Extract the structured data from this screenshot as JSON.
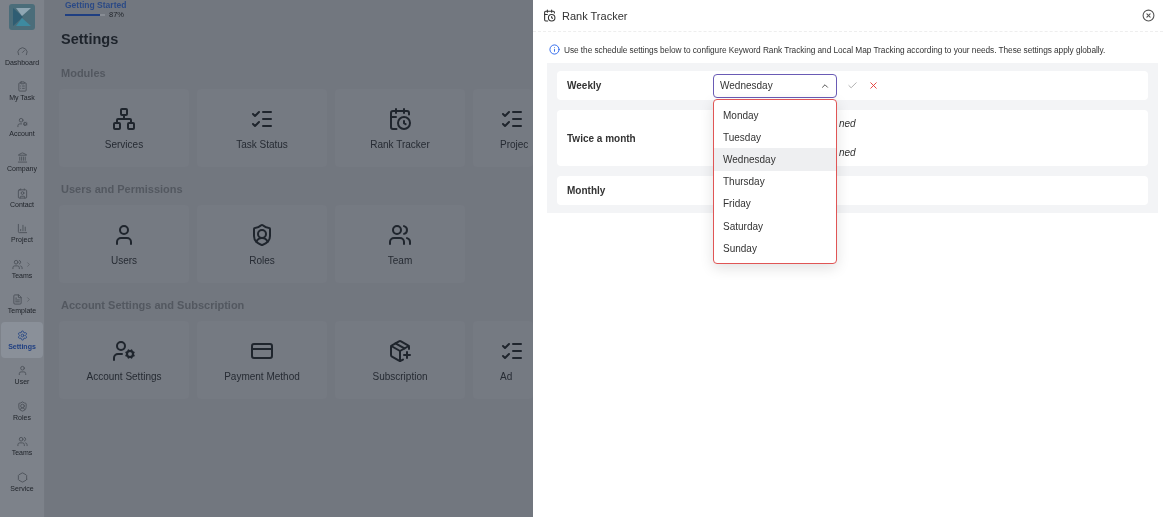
{
  "sidebar": {
    "items": [
      {
        "label": "Dashboard",
        "selected": false,
        "expandable": false
      },
      {
        "label": "My Task",
        "selected": false,
        "expandable": false
      },
      {
        "label": "Account",
        "selected": false,
        "expandable": false
      },
      {
        "label": "Company",
        "selected": false,
        "expandable": false
      },
      {
        "label": "Contact",
        "selected": false,
        "expandable": false
      },
      {
        "label": "Project",
        "selected": false,
        "expandable": false
      },
      {
        "label": "Teams",
        "selected": false,
        "expandable": true
      },
      {
        "label": "Template",
        "selected": false,
        "expandable": true
      },
      {
        "label": "Settings",
        "selected": true,
        "expandable": false
      },
      {
        "label": "User",
        "selected": false,
        "expandable": false
      },
      {
        "label": "Roles",
        "selected": false,
        "expandable": false
      },
      {
        "label": "Teams",
        "selected": false,
        "expandable": false
      },
      {
        "label": "Service",
        "selected": false,
        "expandable": false
      }
    ]
  },
  "progress": {
    "title": "Getting Started",
    "level": 0.87,
    "reading": "87%"
  },
  "page": {
    "title": "Settings",
    "sections": [
      {
        "title": "Modules",
        "cards": [
          {
            "label": "Services"
          },
          {
            "label": "Task Status"
          },
          {
            "label": "Rank Tracker"
          },
          {
            "label": "Projec",
            "partial": true
          }
        ]
      },
      {
        "title": "Users and Permissions",
        "cards": [
          {
            "label": "Users"
          },
          {
            "label": "Roles"
          },
          {
            "label": "Team"
          }
        ]
      },
      {
        "title": "Account Settings and Subscription",
        "cards": [
          {
            "label": "Account Settings"
          },
          {
            "label": "Payment Method"
          },
          {
            "label": "Subscription"
          },
          {
            "label": "Ad",
            "partial": true
          }
        ]
      }
    ]
  },
  "drawer": {
    "title": "Rank Tracker",
    "info": "Use the schedule settings below to configure Keyword Rank Tracking and Local Map Tracking according to your needs. These settings apply globally.",
    "schedules": [
      {
        "label": "Weekly",
        "kind": "select",
        "value": "Wednesday",
        "expanded": true,
        "options": [
          {
            "label": "Monday",
            "selected": false
          },
          {
            "label": "Tuesday",
            "selected": false
          },
          {
            "label": "Wednesday",
            "selected": true
          },
          {
            "label": "Thursday",
            "selected": false
          },
          {
            "label": "Friday",
            "selected": false
          },
          {
            "label": "Saturday",
            "selected": false
          },
          {
            "label": "Sunday",
            "selected": false
          }
        ]
      },
      {
        "label": "Twice a month",
        "kind": "text",
        "lines": [
          "ned",
          "ned"
        ]
      },
      {
        "label": "Monthly",
        "kind": "empty"
      }
    ]
  }
}
